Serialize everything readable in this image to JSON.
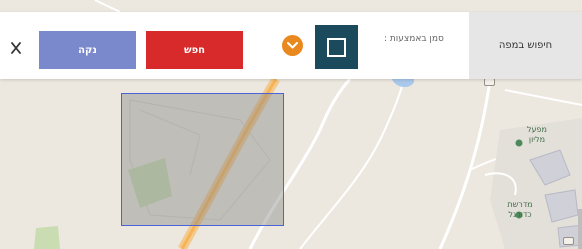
{
  "toolbar": {
    "title": "חיפוש במפה",
    "mark_with_label": "סמן באמצעות :",
    "search_label": "חפש",
    "clear_label": "נקה"
  },
  "map": {
    "labels": {
      "factory": "מפעל\nמליון",
      "school": "מדרשת\nכדורגל"
    }
  },
  "colors": {
    "search_button": "#d82a2a",
    "clear_button": "#7a88cc",
    "shape_button": "#1a4a5c",
    "dropdown_button": "#e8881e",
    "selection_border": "#4a64d8"
  },
  "icons": {
    "shape": "square-icon",
    "dropdown": "chevron-down-icon",
    "close": "close-icon"
  }
}
